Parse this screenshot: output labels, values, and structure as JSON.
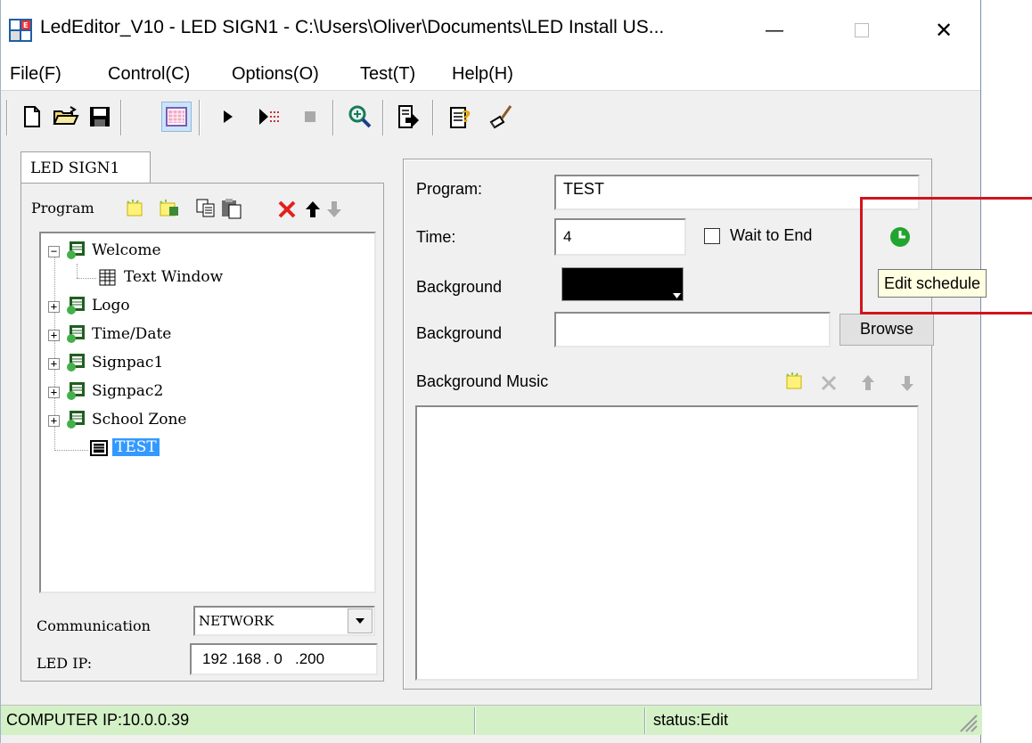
{
  "window": {
    "title": "LedEditor_V10 - LED SIGN1 - C:\\Users\\Oliver\\Documents\\LED Install US...",
    "minimize": "—",
    "close": "✕"
  },
  "menu": [
    "File(F)",
    "Control(C)",
    "Options(O)",
    "Test(T)",
    "Help(H)"
  ],
  "toolbar": {
    "icons": [
      "new-file-icon",
      "open-folder-icon",
      "save-icon",
      "grid-view-icon",
      "play-icon",
      "step-play-icon",
      "stop-icon",
      "zoom-icon",
      "export-icon",
      "help-icon",
      "brush-icon"
    ]
  },
  "left": {
    "tab": "LED SIGN1",
    "program_label": "Program",
    "tree": [
      {
        "label": "Welcome",
        "expander": "−"
      },
      {
        "label": "Text Window"
      },
      {
        "label": "Logo",
        "expander": "+"
      },
      {
        "label": "Time/Date",
        "expander": "+"
      },
      {
        "label": "Signpac1",
        "expander": "+"
      },
      {
        "label": "Signpac2",
        "expander": "+"
      },
      {
        "label": "School Zone",
        "expander": "+"
      },
      {
        "label": "TEST"
      }
    ],
    "communication_label": "Communication",
    "communication_value": "NETWORK",
    "led_ip_label": "LED IP:",
    "led_ip_value": "192 .168 . 0   .200"
  },
  "right": {
    "program_label": "Program:",
    "program_value": "TEST",
    "time_label": "Time:",
    "time_value": "4",
    "wait_label": "Wait to End",
    "background_color_label": "Background",
    "background_image_label": "Background",
    "background_image_value": "",
    "browse": "Browse",
    "music_label": "Background Music",
    "tooltip": "Edit schedule"
  },
  "status": {
    "computer_ip": "COMPUTER IP:10.0.0.39",
    "middle": "",
    "status": "status:Edit"
  },
  "colors": {
    "status_bg": "#d3f0c6",
    "selection": "#3399ff",
    "highlight": "#d0141e",
    "schedule_green": "#22a52e"
  }
}
